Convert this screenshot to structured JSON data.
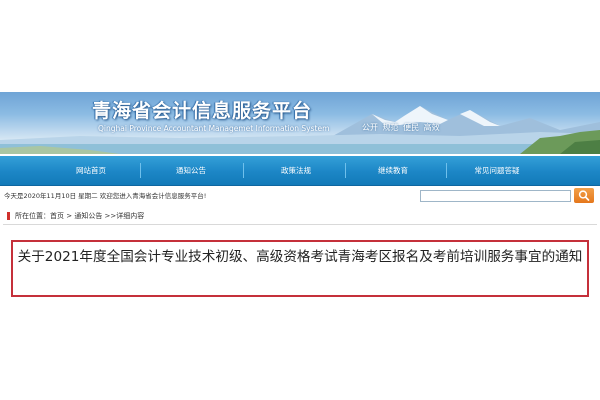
{
  "header": {
    "site_title": "青海省会计信息服务平台",
    "site_subtitle": "Qinghai Province Accountant Managemet Information System",
    "slogans": [
      "公开",
      "规范",
      "便民",
      "高效"
    ]
  },
  "nav": {
    "items": [
      {
        "label": "网站首页"
      },
      {
        "label": "通知公告"
      },
      {
        "label": "政策法规"
      },
      {
        "label": "继续教育"
      },
      {
        "label": "常见问题答疑"
      }
    ]
  },
  "info": {
    "date_text": "今天是2020年11月10日 星期二   欢迎您进入青海省会计信息服务平台!",
    "search_value": ""
  },
  "breadcrumb": {
    "prefix": "所在位置：",
    "items": [
      {
        "label": "首页"
      },
      {
        "label": "通知公告"
      },
      {
        "label": "详细内容"
      }
    ],
    "sep1": " > ",
    "sep2": " >>"
  },
  "article": {
    "title": "关于2021年度全国会计专业技术初级、高级资格考试青海考区报名及考前培训服务事宜的通知"
  },
  "colors": {
    "nav_bg": "#1c86c6",
    "highlight_border": "#c5303a",
    "search_button": "#e5771b"
  },
  "icons": {
    "search": "search-icon",
    "breadcrumb": "location-marker-icon"
  }
}
